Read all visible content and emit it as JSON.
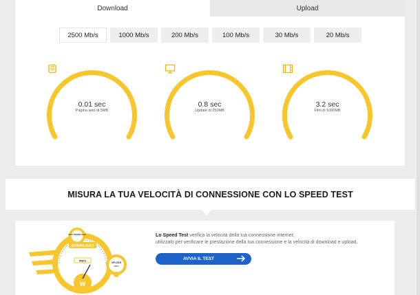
{
  "tabs": [
    {
      "label": "Download",
      "active": true
    },
    {
      "label": "Upload",
      "active": false
    }
  ],
  "speeds": [
    "2500 Mb/s",
    "1000 Mb/s",
    "200 Mb/s",
    "100 Mb/s",
    "30 Mb/s",
    "20 Mb/s"
  ],
  "selected_speed": "2500 Mb/s",
  "gauges": [
    {
      "value": "0.01 sec",
      "label": "Pagina web di 5MB",
      "icon": "book-icon"
    },
    {
      "value": "0.8 sec",
      "label": "Update di 250MB",
      "icon": "monitor-icon"
    },
    {
      "value": "3.2 sec",
      "label": "Film di 1000MB",
      "icon": "film-icon"
    }
  ],
  "section_title": "MISURA LA TUA VELOCITÀ DI CONNESSIONE CON LO SPEED TEST",
  "promo": {
    "brand": "Lo Speed Test",
    "line1_rest": " verifica la velocità della tua connessione internet:",
    "line2": "utilizzalo per verificare le prestazione della tua connessione e la velocità di download e upload.",
    "cta": "AVVIA IL TEST"
  },
  "illustration": {
    "top_badge": "MAX DOWNLOAD",
    "main_label": "DOWNLOAD",
    "main_unit": "MB/S",
    "side_label": "UPLOAD",
    "side_unit": "MB/S",
    "logo": "W"
  },
  "colors": {
    "accent": "#f7c52c",
    "button": "#1e64c8",
    "background": "#ececec"
  }
}
